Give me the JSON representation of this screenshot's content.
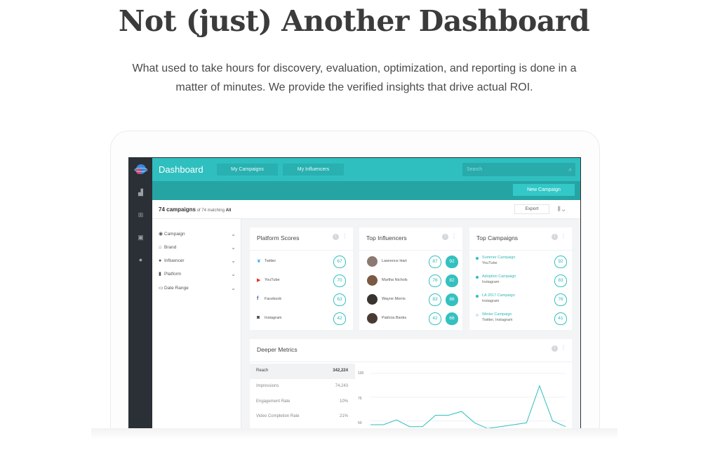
{
  "hero": {
    "title": "Not (just) Another Dashboard",
    "subtitle_line1": "What used to take hours for discovery, evaluation, optimization, and reporting is done in a",
    "subtitle_line2": "matter of minutes. We provide the verified insights that drive actual ROI."
  },
  "app": {
    "title": "Dashboard",
    "tabs": [
      "My Campaigns",
      "My Influencers"
    ],
    "search_placeholder": "Search",
    "new_campaign_label": "New Campaign",
    "count_bold": "74 campaigns",
    "count_rest": " of 74 matching ",
    "count_all": "All",
    "export_label": "Export",
    "accent_color": "#2fbfbf"
  },
  "filters": [
    {
      "label": "Campaign",
      "icon": "circle-icon"
    },
    {
      "label": "Brand",
      "icon": "home-icon"
    },
    {
      "label": "Influencer",
      "icon": "person-icon"
    },
    {
      "label": "Platform",
      "icon": "phone-icon"
    },
    {
      "label": "Date Range",
      "icon": "calendar-icon"
    }
  ],
  "platform_scores": {
    "title": "Platform Scores",
    "rows": [
      {
        "label": "Twitter",
        "score": "67",
        "icon": "twitter-icon"
      },
      {
        "label": "YouTube",
        "score": "70",
        "icon": "youtube-icon"
      },
      {
        "label": "Facebook",
        "score": "63",
        "icon": "facebook-icon"
      },
      {
        "label": "Instagram",
        "score": "42",
        "icon": "instagram-icon"
      }
    ]
  },
  "top_influencers": {
    "title": "Top Influencers",
    "rows": [
      {
        "name": "Lawrence Hart",
        "score1": "87",
        "score2": "92"
      },
      {
        "name": "Martha Nichols",
        "score1": "76",
        "score2": "82"
      },
      {
        "name": "Wayne Morris",
        "score1": "83",
        "score2": "86"
      },
      {
        "name": "Patricia Banks",
        "score1": "42",
        "score2": "66"
      }
    ]
  },
  "top_campaigns": {
    "title": "Top Campaigns",
    "rows": [
      {
        "name": "Summer Campaign",
        "platforms": "YouTube",
        "score": "92"
      },
      {
        "name": "Adoption Campaign",
        "platforms": "Instagram",
        "score": "83"
      },
      {
        "name": "LA 2017 Campaign",
        "platforms": "Instagram",
        "score": "76"
      },
      {
        "name": "Winter Campaign",
        "platforms": "Twitter, Instagram",
        "score": "41"
      }
    ]
  },
  "deeper_metrics": {
    "title": "Deeper Metrics",
    "rows": [
      {
        "label": "Reach",
        "value": "342,224"
      },
      {
        "label": "Impressions",
        "value": "74,243"
      },
      {
        "label": "Engagement Rate",
        "value": "10%"
      },
      {
        "label": "Video Completion Rate",
        "value": "21%"
      }
    ],
    "y_ticks": [
      "100",
      "75",
      "50"
    ]
  },
  "chart_data": {
    "type": "line",
    "title": "",
    "xlabel": "",
    "ylabel": "",
    "ylim": [
      40,
      100
    ],
    "x": [
      0,
      1,
      2,
      3,
      4,
      5,
      6,
      7,
      8,
      9,
      10,
      11,
      12,
      13,
      14,
      15
    ],
    "series": [
      {
        "values": [
          46,
          46,
          51,
          44,
          44,
          56,
          56,
          60,
          48,
          42,
          44,
          46,
          48,
          87,
          50,
          44
        ]
      }
    ]
  }
}
